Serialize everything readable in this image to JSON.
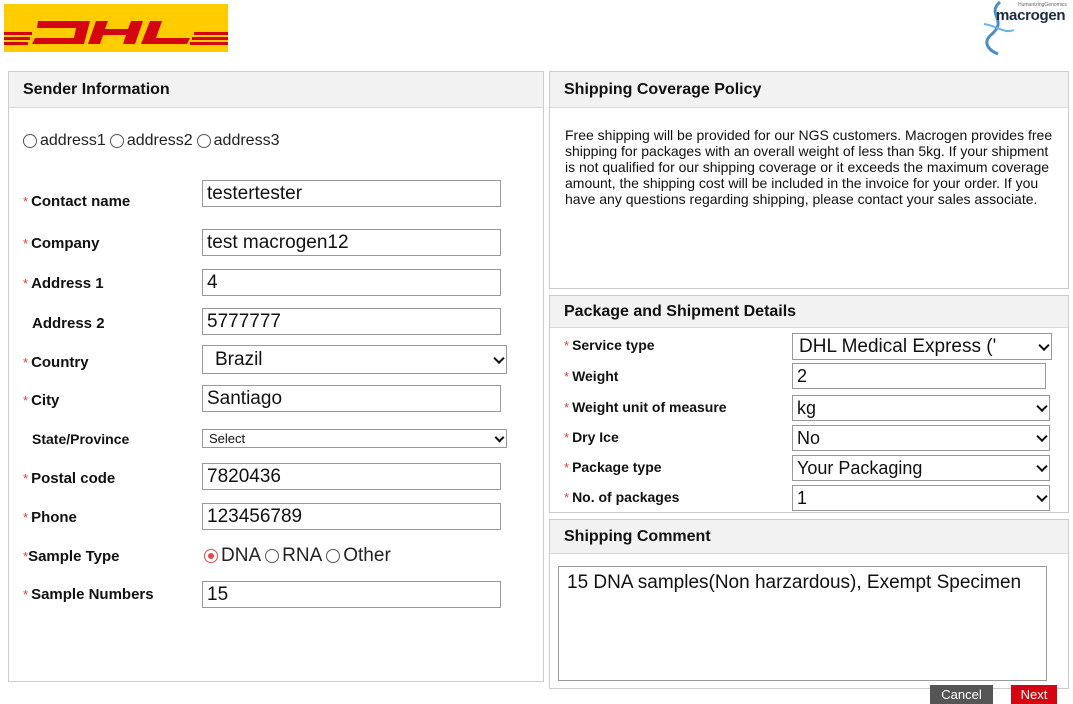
{
  "brand": {
    "macrogen_tagline": "HumanizingGenomics",
    "macrogen_name": "macrogen",
    "dhl_color": "#ffcc00",
    "dhl_red": "#d40511"
  },
  "sender": {
    "title": "Sender Information",
    "address_options": [
      "address1",
      "address2",
      "address3"
    ],
    "fields": {
      "contact_name": {
        "label": "Contact name",
        "value": "testertester"
      },
      "company": {
        "label": "Company",
        "value": "test macrogen12"
      },
      "address1": {
        "label": "Address 1",
        "value": "4"
      },
      "address2": {
        "label": "Address 2",
        "value": "5777777"
      },
      "country": {
        "label": "Country",
        "value": "Brazil"
      },
      "city": {
        "label": "City",
        "value": "Santiago"
      },
      "state": {
        "label": "State/Province",
        "value": "Select"
      },
      "postal": {
        "label": "Postal code",
        "value": "7820436"
      },
      "phone": {
        "label": "Phone",
        "value": "123456789"
      },
      "sample_type": {
        "label": "Sample Type",
        "options": [
          "DNA",
          "RNA",
          "Other"
        ],
        "selected": "DNA"
      },
      "sample_numbers": {
        "label": "Sample Numbers",
        "value": "15"
      }
    }
  },
  "policy": {
    "title": "Shipping Coverage Policy",
    "text": "Free shipping will be provided for our NGS customers. Macrogen provides free shipping for packages with an overall weight of less than 5kg. If your shipment is not qualified for our shipping coverage or it exceeds the maximum coverage amount, the shipping cost will be included in the invoice for your order. If you have any questions regarding shipping, please contact your sales associate."
  },
  "package": {
    "title": "Package and Shipment Details",
    "service_type": {
      "label": "Service type",
      "value": "DHL Medical Express ('"
    },
    "weight": {
      "label": "Weight",
      "value": "2"
    },
    "weight_unit": {
      "label": "Weight unit of measure",
      "value": "kg"
    },
    "dry_ice": {
      "label": "Dry Ice",
      "value": "No"
    },
    "package_type": {
      "label": "Package type",
      "value": "Your Packaging"
    },
    "num_packages": {
      "label": "No. of packages",
      "value": "1"
    }
  },
  "comment": {
    "title": "Shipping Comment",
    "value": "15  DNA samples(Non harzardous), Exempt Specimen"
  },
  "actions": {
    "cancel": "Cancel",
    "next": "Next"
  }
}
